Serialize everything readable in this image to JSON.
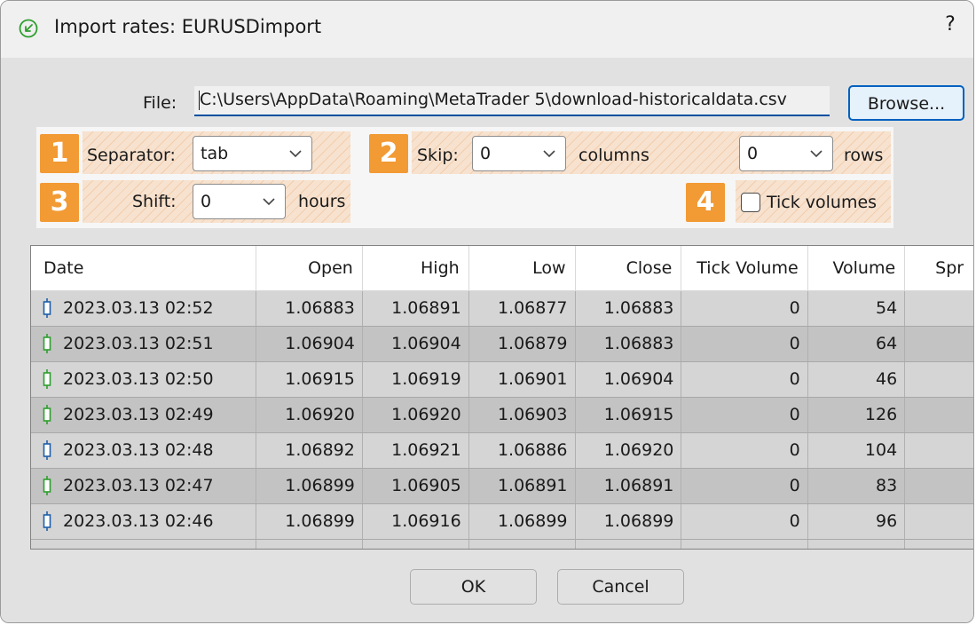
{
  "window": {
    "title": "Import rates: EURUSDimport",
    "help_label": "?"
  },
  "file": {
    "label": "File:",
    "value": "C:\\Users\\AppData\\Roaming\\MetaTrader 5\\download-historicaldata.csv",
    "browse_label": "Browse..."
  },
  "badges": [
    "1",
    "2",
    "3",
    "4"
  ],
  "options": {
    "separator_label": "Separator:",
    "separator_value": "tab",
    "skip_label": "Skip:",
    "skip_columns_value": "0",
    "columns_label": "columns",
    "skip_rows_value": "0",
    "rows_label": "rows",
    "shift_label": "Shift:",
    "shift_value": "0",
    "hours_label": "hours",
    "tick_volumes_label": "Tick volumes",
    "tick_volumes_checked": false
  },
  "table": {
    "columns": [
      "Date",
      "Open",
      "High",
      "Low",
      "Close",
      "Tick Volume",
      "Volume",
      "Spr"
    ],
    "rows": [
      {
        "date": "2023.03.13 02:52",
        "candle": "bear",
        "open": "1.06883",
        "high": "1.06891",
        "low": "1.06877",
        "close": "1.06883",
        "tick_volume": "0",
        "volume": "54"
      },
      {
        "date": "2023.03.13 02:51",
        "candle": "bull",
        "open": "1.06904",
        "high": "1.06904",
        "low": "1.06879",
        "close": "1.06883",
        "tick_volume": "0",
        "volume": "64"
      },
      {
        "date": "2023.03.13 02:50",
        "candle": "bull",
        "open": "1.06915",
        "high": "1.06919",
        "low": "1.06901",
        "close": "1.06904",
        "tick_volume": "0",
        "volume": "46"
      },
      {
        "date": "2023.03.13 02:49",
        "candle": "bull",
        "open": "1.06920",
        "high": "1.06920",
        "low": "1.06903",
        "close": "1.06915",
        "tick_volume": "0",
        "volume": "126"
      },
      {
        "date": "2023.03.13 02:48",
        "candle": "bear",
        "open": "1.06892",
        "high": "1.06921",
        "low": "1.06886",
        "close": "1.06920",
        "tick_volume": "0",
        "volume": "104"
      },
      {
        "date": "2023.03.13 02:47",
        "candle": "bull",
        "open": "1.06899",
        "high": "1.06905",
        "low": "1.06891",
        "close": "1.06891",
        "tick_volume": "0",
        "volume": "83"
      },
      {
        "date": "2023.03.13 02:46",
        "candle": "bear",
        "open": "1.06899",
        "high": "1.06916",
        "low": "1.06899",
        "close": "1.06899",
        "tick_volume": "0",
        "volume": "96"
      }
    ]
  },
  "buttons": {
    "ok_label": "OK",
    "cancel_label": "Cancel"
  },
  "colors": {
    "accent": "#0060c0",
    "badge": "#f29a34",
    "candle_bull": "#2e9e2e",
    "candle_bear": "#1f5fa8"
  }
}
